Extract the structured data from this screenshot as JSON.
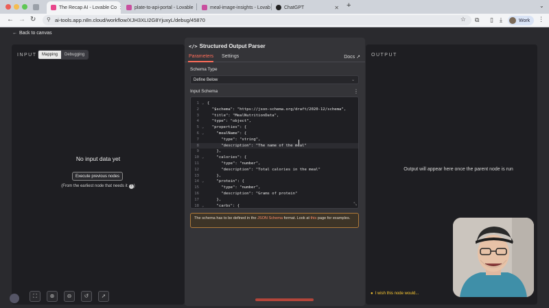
{
  "browser": {
    "tabs": [
      {
        "title": "The Recap AI - Lovable Co",
        "active": true
      },
      {
        "title": "plate-to-api-portal - Lovable",
        "active": false
      },
      {
        "title": "meal-image-insights - Lovab",
        "active": false
      },
      {
        "title": "ChatGPT",
        "active": false
      }
    ],
    "url": "ai-tools.app.n8n.cloud/workflow/XJH3XLI2G8YjuxyL/debug/45870",
    "profile": "Work"
  },
  "header": {
    "back_label": "Back to canvas"
  },
  "input_panel": {
    "label": "INPUT",
    "toggle": [
      "Mapping",
      "Debugging"
    ],
    "empty_title": "No input data yet",
    "execute_button": "Execute previous nodes",
    "hint": "(From the earliest node that needs it"
  },
  "node": {
    "title": "Structured Output Parser",
    "tabs": [
      "Parameters",
      "Settings"
    ],
    "docs_label": "Docs",
    "schema_type_label": "Schema Type",
    "schema_type_value": "Define Below",
    "input_schema_label": "Input Schema",
    "code": [
      {
        "n": "1",
        "fold": "⌄",
        "text": "{"
      },
      {
        "n": "2",
        "fold": "",
        "text": "  \"$schema\": \"https://json-schema.org/draft/2020-12/schema\","
      },
      {
        "n": "3",
        "fold": "",
        "text": "  \"title\": \"MealNutritionData\","
      },
      {
        "n": "4",
        "fold": "",
        "text": "  \"type\": \"object\","
      },
      {
        "n": "5",
        "fold": "⌄",
        "text": "  \"properties\": {"
      },
      {
        "n": "6",
        "fold": "⌄",
        "text": "    \"mealName\": {"
      },
      {
        "n": "7",
        "fold": "",
        "text": "      \"type\": \"string\","
      },
      {
        "n": "8",
        "fold": "",
        "text": "      \"description\": \"The name of the meal\""
      },
      {
        "n": "9",
        "fold": "",
        "text": "    },"
      },
      {
        "n": "10",
        "fold": "⌄",
        "text": "    \"calories\": {"
      },
      {
        "n": "11",
        "fold": "",
        "text": "      \"type\": \"number\","
      },
      {
        "n": "12",
        "fold": "",
        "text": "      \"description\": \"Total calories in the meal\""
      },
      {
        "n": "13",
        "fold": "",
        "text": "    },"
      },
      {
        "n": "14",
        "fold": "⌄",
        "text": "    \"protein\": {"
      },
      {
        "n": "15",
        "fold": "",
        "text": "      \"type\": \"number\","
      },
      {
        "n": "16",
        "fold": "",
        "text": "      \"description\": \"Grams of protein\""
      },
      {
        "n": "17",
        "fold": "",
        "text": "    },"
      },
      {
        "n": "18",
        "fold": "⌄",
        "text": "    \"carbs\": {"
      }
    ],
    "notice": {
      "pre": "The schema has to be defined in the ",
      "link1": "JSON Schema",
      "mid": " format. Look at ",
      "link2": "this",
      "post": " page for examples."
    }
  },
  "output_panel": {
    "label": "OUTPUT",
    "message": "Output will appear here once the parent node is run",
    "feedback": "I wish this node would..."
  },
  "colors": {
    "accent": "#ff6d5a",
    "panel": "#1e1e22",
    "node_bg": "#343438"
  }
}
